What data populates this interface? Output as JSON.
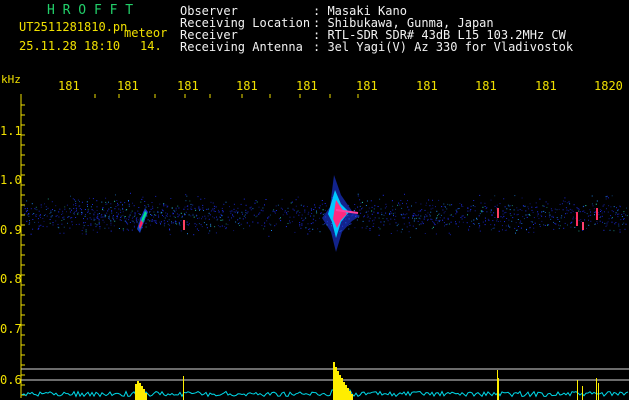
{
  "header": {
    "title": "H R O F F T",
    "filename": "UT2511281810.pn",
    "date_time": "25.11.28 18:10",
    "frame_index": "14.",
    "classification": "meteor",
    "info_rows": [
      {
        "label": "Observer",
        "value": ": Masaki Kano"
      },
      {
        "label": "Receiving Location",
        "value": ": Shibukawa, Gunma, Japan"
      },
      {
        "label": "Receiver",
        "value": ": RTL-SDR SDR# 43dB L15 103.2MHz CW"
      },
      {
        "label": "Receiving Antenna",
        "value": ": 3el Yagi(V) Az 330 for Vladivostok"
      }
    ]
  },
  "spectrogram": {
    "y_unit": "kHz",
    "time_labels": [
      "181",
      "181",
      "181",
      "181",
      "181",
      "181",
      "181",
      "181",
      "181",
      "1820"
    ],
    "freq_ticks": [
      "1.1",
      "1.0",
      "0.9",
      "0.8",
      "0.7",
      "0.6"
    ],
    "colors": {
      "background": "#000000",
      "header_text": "#f2f2f2",
      "axis_text": "#f0e000",
      "title_text": "#22d06a",
      "level_trace": "#00d8e8",
      "echo_fill": "#ffee00",
      "noise": "#2030ff"
    }
  }
}
